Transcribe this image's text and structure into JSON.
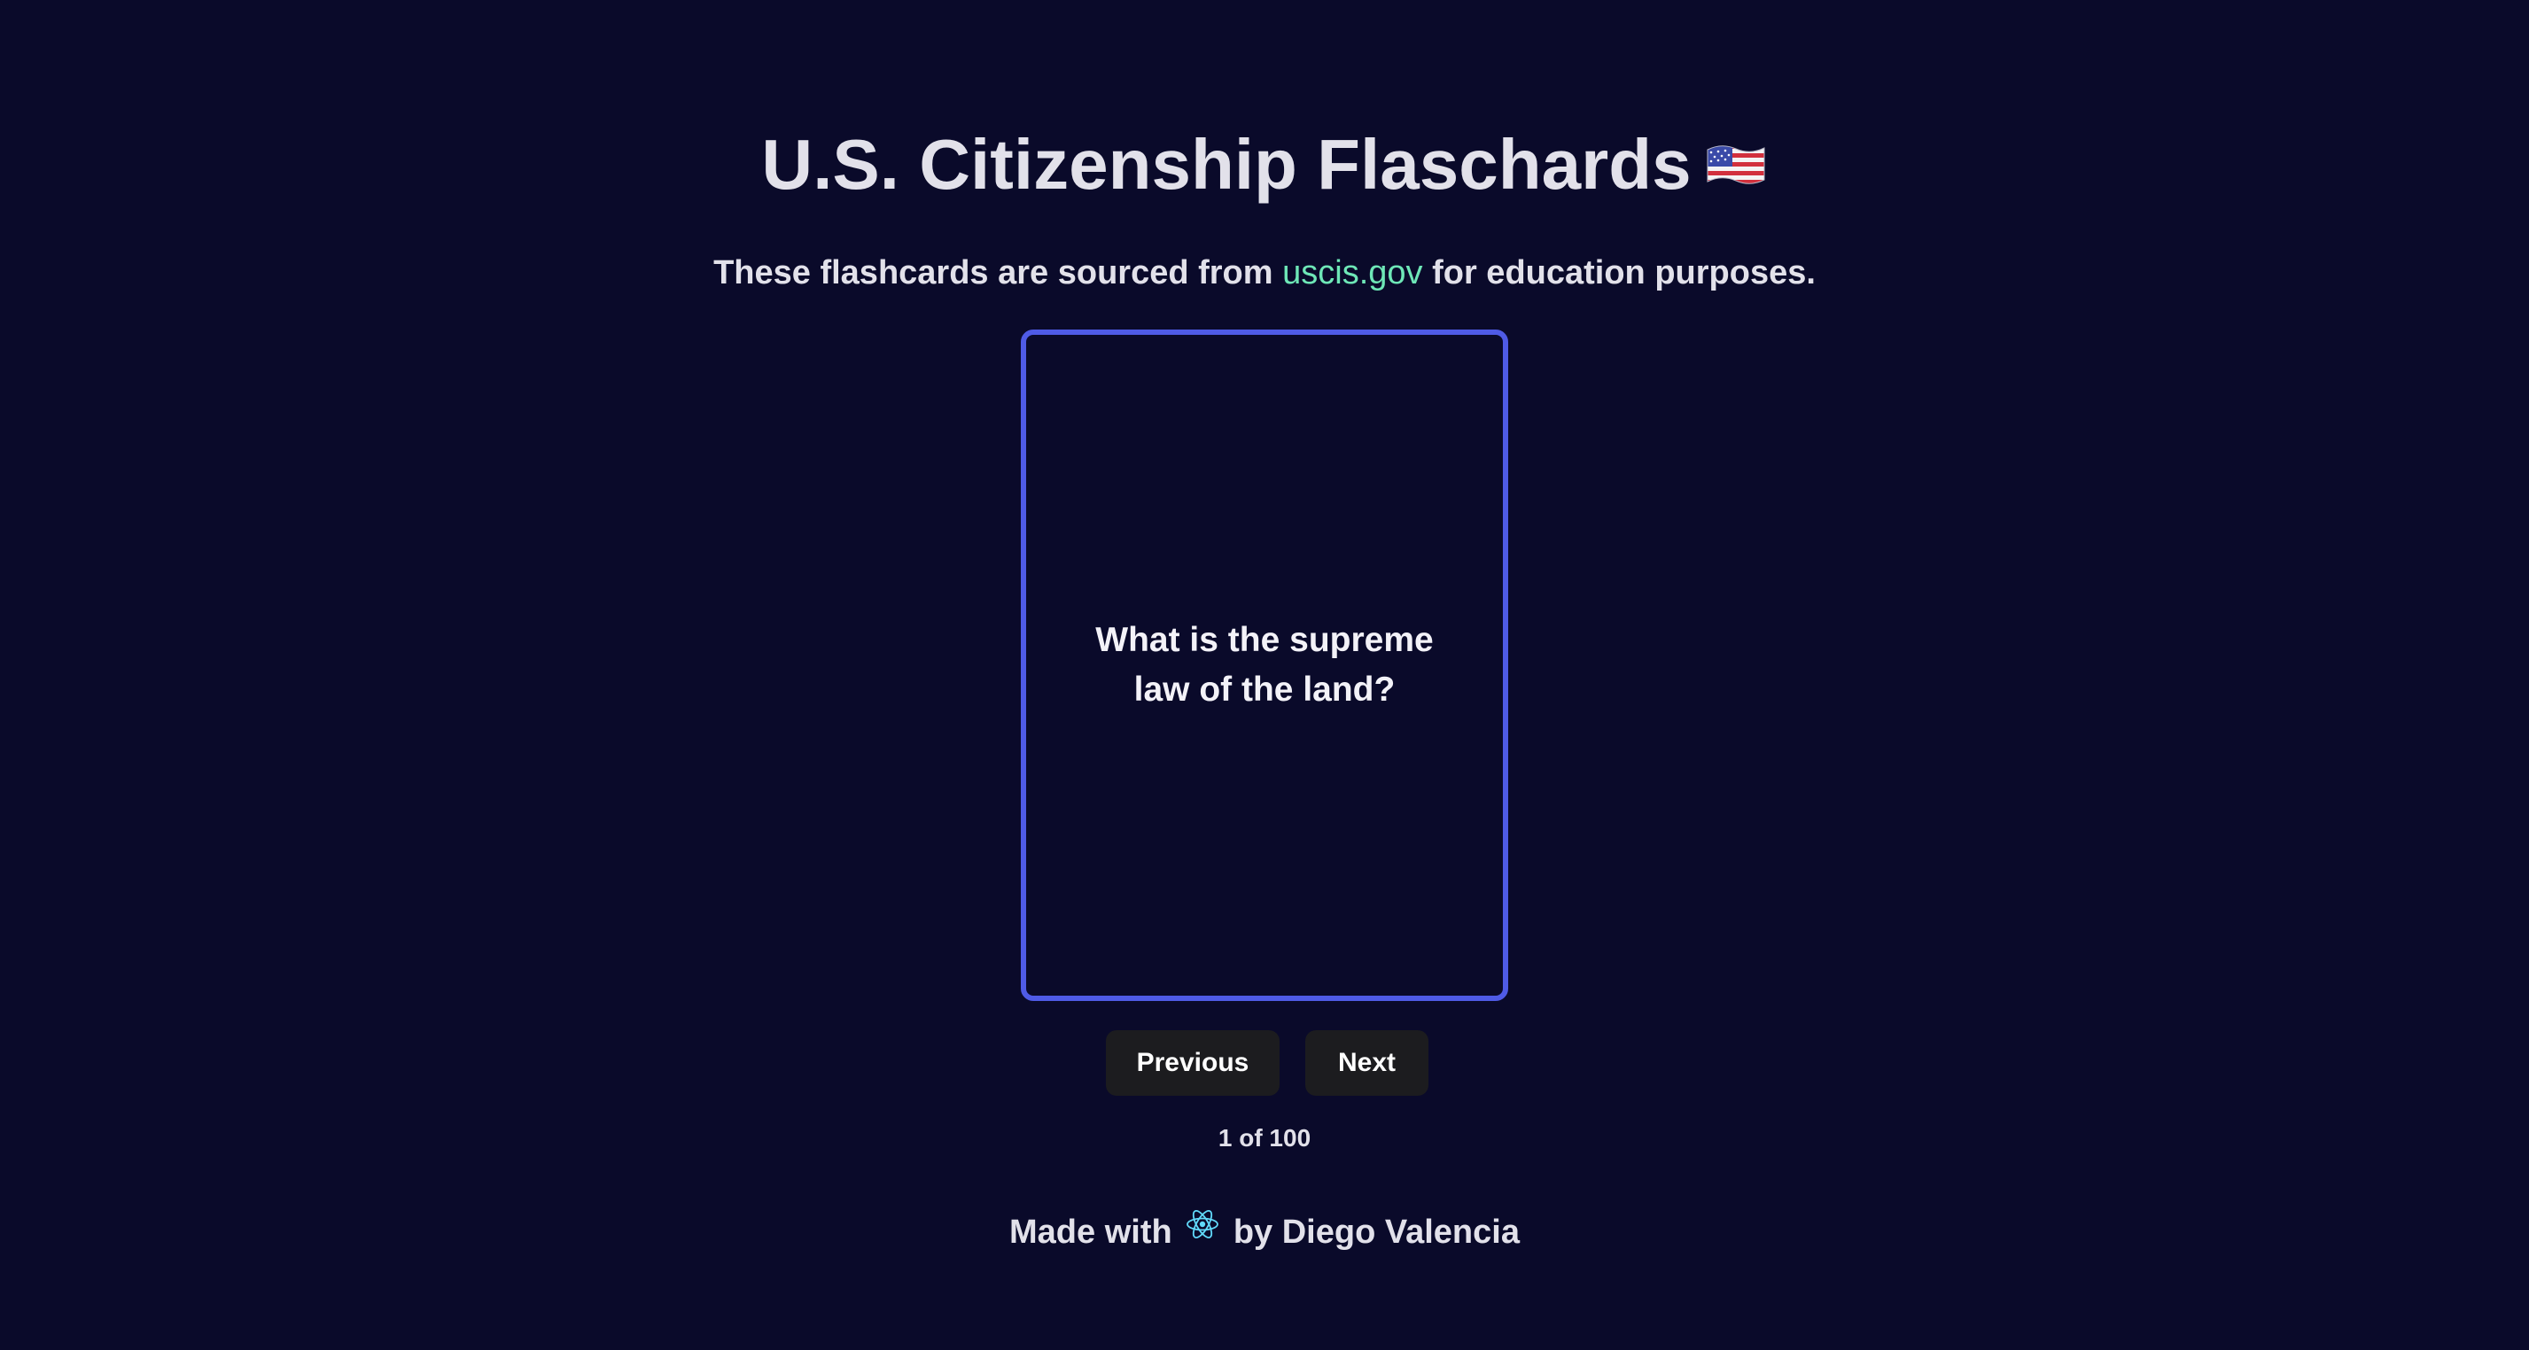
{
  "header": {
    "title": "U.S. Citizenship Flaschards",
    "flag_icon": "us-flag-icon"
  },
  "intro": {
    "prefix": "These flashcards are sourced from",
    "link_text": "uscis.gov",
    "suffix": "for education purposes.",
    "link_color": "#6ee7b7"
  },
  "card": {
    "question": "What is the supreme law of the land?",
    "border_color": "#4f5be6"
  },
  "controls": {
    "previous_label": "Previous",
    "next_label": "Next"
  },
  "progress": {
    "current": 1,
    "total": 100,
    "text": "1 of 100"
  },
  "footer": {
    "prefix": "Made with",
    "icon": "react-atom-icon",
    "suffix": "by Diego Valencia"
  },
  "colors": {
    "background": "#0a0a2a",
    "text": "#e2e1ea",
    "button_bg": "#1c1c1f",
    "react_icon": "#61dafb"
  }
}
